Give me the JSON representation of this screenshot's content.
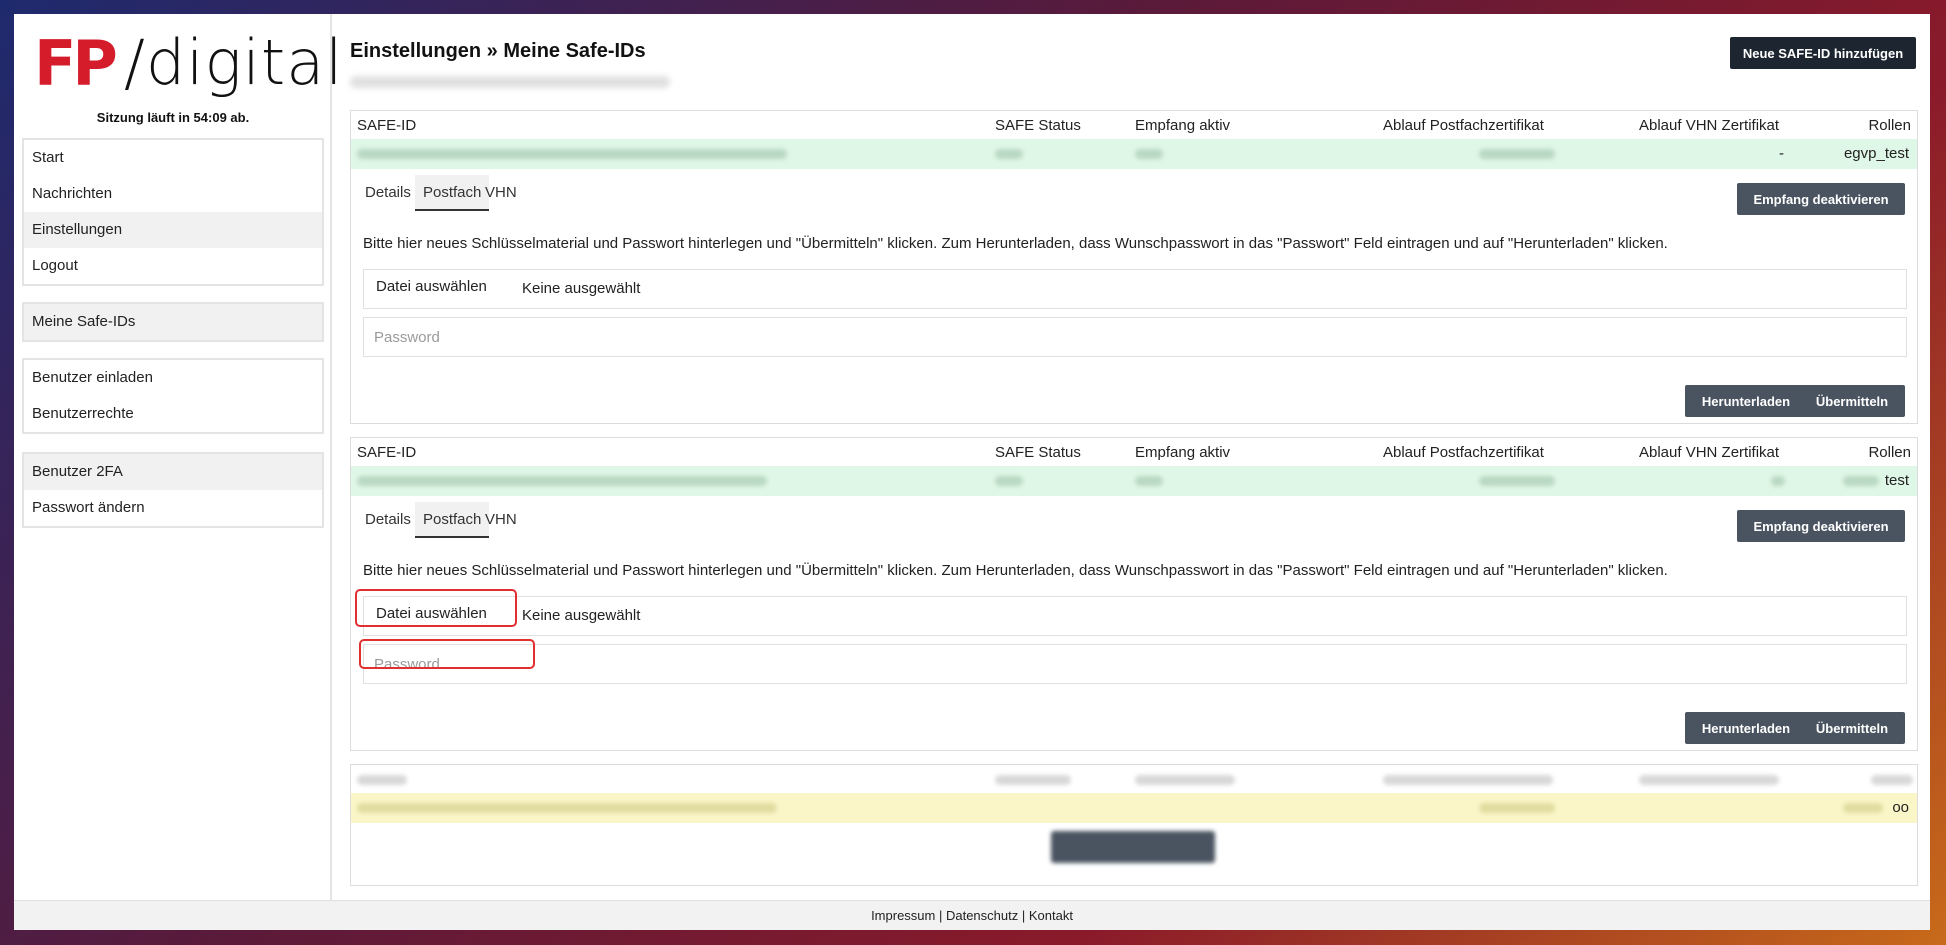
{
  "brand": {
    "logo_fp": "FP",
    "logo_text": "/digital",
    "session": "Sitzung läuft in 54:09 ab."
  },
  "sidebar": {
    "group1": [
      "Start",
      "Nachrichten",
      "Einstellungen",
      "Logout"
    ],
    "group2": [
      "Meine Safe-IDs"
    ],
    "group3": [
      "Benutzer einladen",
      "Benutzerrechte"
    ],
    "group4": [
      "Benutzer 2FA",
      "Passwort ändern"
    ]
  },
  "page": {
    "title": "Einstellungen » Meine Safe-IDs",
    "new_button": "Neue SAFE-ID hinzufügen"
  },
  "table_headers": [
    "SAFE-ID",
    "SAFE Status",
    "Empfang aktiv",
    "Ablauf Postfachzertifikat",
    "Ablauf VHN Zertifikat",
    "Rollen"
  ],
  "entries": [
    {
      "vhn_expiry": "-",
      "roles": "egvp_test",
      "tabs": [
        "Details",
        "Postfach",
        "VHN"
      ],
      "deactivate_button": "Empfang deaktivieren",
      "info": "Bitte hier neues Schlüsselmaterial und Passwort hinterlegen und \"Übermitteln\" klicken. Zum Herunterladen, dass Wunschpasswort in das \"Passwort\" Feld eintragen und auf \"Herunterladen\" klicken.",
      "file_button": "Datei auswählen",
      "file_status": "Keine ausgewählt",
      "password_placeholder": "Password",
      "download_button": "Herunterladen",
      "submit_button": "Übermitteln"
    },
    {
      "roles": "test",
      "tabs": [
        "Details",
        "Postfach",
        "VHN"
      ],
      "deactivate_button": "Empfang deaktivieren",
      "info": "Bitte hier neues Schlüsselmaterial und Passwort hinterlegen und \"Übermitteln\" klicken. Zum Herunterladen, dass Wunschpasswort in das \"Passwort\" Feld eintragen und auf \"Herunterladen\" klicken.",
      "file_button": "Datei auswählen",
      "file_status": "Keine ausgewählt",
      "password_placeholder": "Password",
      "download_button": "Herunterladen",
      "submit_button": "Übermitteln"
    }
  ],
  "third_entry": {
    "roles": "oo"
  },
  "footer": {
    "impressum": "Impressum",
    "sep": " | ",
    "datenschutz": "Datenschutz",
    "kontakt": "Kontakt"
  }
}
